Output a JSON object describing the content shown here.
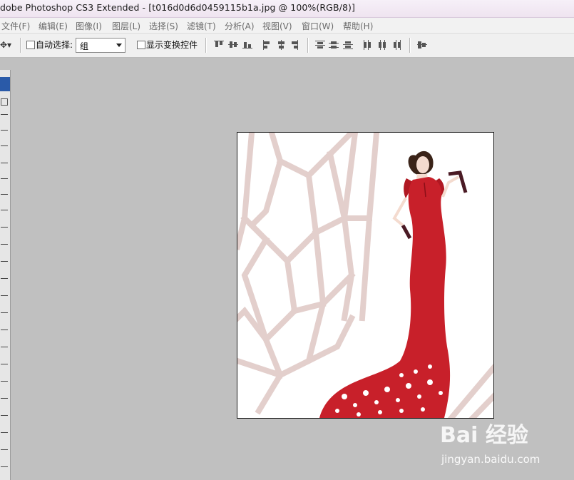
{
  "window": {
    "title": "dobe Photoshop CS3 Extended - [t016d0d6d0459115b1a.jpg @ 100%(RGB/8)]"
  },
  "menu": [
    {
      "label": "文件(F)"
    },
    {
      "label": "编辑(E)"
    },
    {
      "label": "图像(I)"
    },
    {
      "label": "图层(L)"
    },
    {
      "label": "选择(S)"
    },
    {
      "label": "滤镜(T)"
    },
    {
      "label": "分析(A)"
    },
    {
      "label": "视图(V)"
    },
    {
      "label": "窗口(W)"
    },
    {
      "label": "帮助(H)"
    }
  ],
  "options": {
    "move_tool_icon": "move-icon",
    "auto_select_label": "自动选择:",
    "auto_select_checked": false,
    "auto_select_value": "组",
    "show_transform_label": "显示变换控件",
    "show_transform_checked": false
  },
  "watermark": {
    "logo": "Bai 经验",
    "url": "jingyan.baidu.com"
  },
  "colors": {
    "dress": "#c8202a",
    "frame": "#e3cfcc",
    "canvas_bg": "#c0c0c0"
  }
}
